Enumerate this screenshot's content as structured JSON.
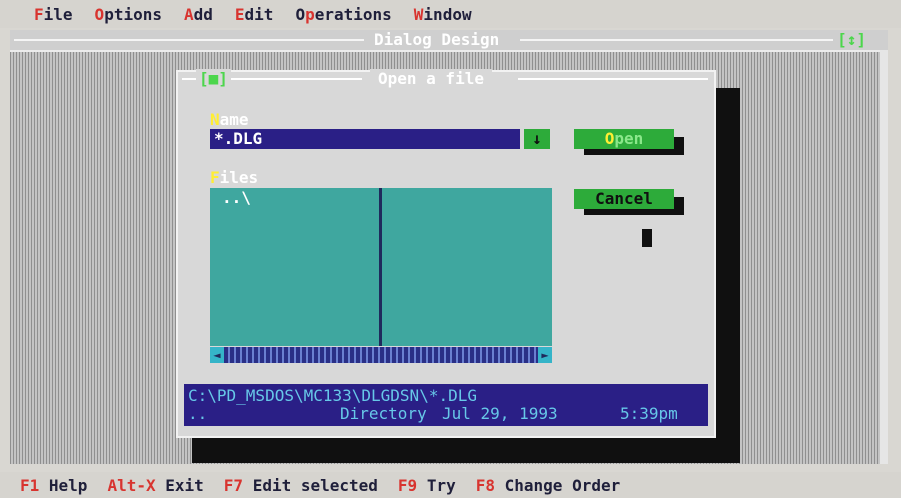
{
  "menubar": {
    "items": [
      {
        "hot": "F",
        "rest": "ile"
      },
      {
        "hot": "O",
        "rest": "ptions"
      },
      {
        "hot": "A",
        "rest": "dd"
      },
      {
        "hot": "E",
        "rest": "dit"
      },
      {
        "pre": "O",
        "hot": "p",
        "rest": "erations"
      },
      {
        "hot": "W",
        "rest": "indow"
      }
    ]
  },
  "desktop": {
    "title": "Dialog Design",
    "zoom_label": "[↕]"
  },
  "dialog": {
    "close_label": "[■]",
    "title": "Open a file",
    "name_label_hot": "N",
    "name_label_rest": "ame",
    "name_value": "*.DLG",
    "history_icon": "↓",
    "files_label_hot": "F",
    "files_label_rest": "iles",
    "file_entries": [
      "..\\"
    ],
    "open_button_hot": "O",
    "open_button_rest": "pen",
    "cancel_button": "Cancel",
    "scroll_left": "◄",
    "scroll_right": "►",
    "info_path": "C:\\PD_MSDOS\\MC133\\DLGDSN\\*.DLG",
    "info_name": "..",
    "info_type": "Directory",
    "info_date": "Jul 29, 1993",
    "info_time": "5:39pm"
  },
  "statusbar": {
    "items": [
      {
        "key": "F1",
        "label": "Help"
      },
      {
        "key": "Alt-X",
        "label": "Exit"
      },
      {
        "key": "F7",
        "label": "Edit selected"
      },
      {
        "key": "F9",
        "label": "Try"
      },
      {
        "key": "F8",
        "label": "Change Order"
      }
    ]
  },
  "colors": {
    "menu_hotkey": "#d8342f",
    "dialog_bg": "#d8d8d8",
    "input_bg": "#2a1f86",
    "button_green": "#2dab3a",
    "list_teal": "#3fa79f"
  }
}
